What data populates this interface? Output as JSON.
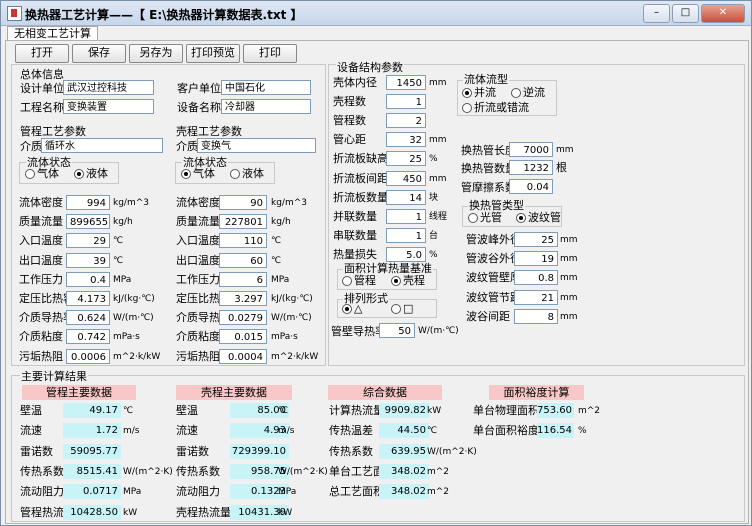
{
  "window": {
    "title": "换热器工艺计算——【 E:\\换热器计算数据表.txt 】",
    "btn_min": "–",
    "btn_max": "□",
    "btn_close": "✕"
  },
  "tab": "无相变工艺计算",
  "toolbar": {
    "open": "打开",
    "save": "保存",
    "saveas": "另存为",
    "preview": "打印预览",
    "print": "打印"
  },
  "general": {
    "title": "总体信息",
    "design_unit_label": "设计单位",
    "design_unit": "武汉过控科技",
    "customer_label": "客户单位",
    "customer": "中国石化",
    "project_label": "工程名称",
    "project": "变换装置",
    "equipment_label": "设备名称",
    "equipment": "冷却器"
  },
  "tube": {
    "title": "管程工艺参数",
    "medium_label": "介质",
    "medium": "循环水",
    "state_title": "流体状态",
    "gas": "气体",
    "liquid": "液体",
    "rows": [
      {
        "label": "流体密度",
        "value": "994",
        "unit": "kg/m^3"
      },
      {
        "label": "质量流量",
        "value": "899655",
        "unit": "kg/h"
      },
      {
        "label": "入口温度",
        "value": "29",
        "unit": "℃"
      },
      {
        "label": "出口温度",
        "value": "39",
        "unit": "℃"
      },
      {
        "label": "工作压力",
        "value": "0.4",
        "unit": "MPa"
      },
      {
        "label": "定压比热容",
        "value": "4.173",
        "unit": "kJ/(kg·℃)"
      },
      {
        "label": "介质导热率",
        "value": "0.624",
        "unit": "W/(m·℃)"
      },
      {
        "label": "介质粘度",
        "value": "0.742",
        "unit": "mPa·s"
      },
      {
        "label": "污垢热阻",
        "value": "0.0006",
        "unit": "m^2·k/kW"
      }
    ]
  },
  "shell": {
    "title": "壳程工艺参数",
    "medium_label": "介质",
    "medium": "变换气",
    "state_title": "流体状态",
    "gas": "气体",
    "liquid": "液体",
    "rows": [
      {
        "label": "流体密度",
        "value": "90",
        "unit": "kg/m^3"
      },
      {
        "label": "质量流量",
        "value": "227801",
        "unit": "kg/h"
      },
      {
        "label": "入口温度",
        "value": "110",
        "unit": "℃"
      },
      {
        "label": "出口温度",
        "value": "60",
        "unit": "℃"
      },
      {
        "label": "工作压力",
        "value": "6",
        "unit": "MPa"
      },
      {
        "label": "定压比热容",
        "value": "3.297",
        "unit": "kJ/(kg·℃)"
      },
      {
        "label": "介质导热率",
        "value": "0.0279",
        "unit": "W/(m·℃)"
      },
      {
        "label": "介质粘度",
        "value": "0.015",
        "unit": "mPa·s"
      },
      {
        "label": "污垢热阻",
        "value": "0.0004",
        "unit": "m^2·k/kW"
      }
    ]
  },
  "struct": {
    "title": "设备结构参数",
    "rows": [
      {
        "label": "壳体内径",
        "value": "1450",
        "unit": "mm"
      },
      {
        "label": "壳程数",
        "value": "1",
        "unit": ""
      },
      {
        "label": "管程数",
        "value": "2",
        "unit": ""
      },
      {
        "label": "管心距",
        "value": "32",
        "unit": "mm"
      },
      {
        "label": "折流板缺高",
        "value": "25",
        "unit": "%"
      },
      {
        "label": "折流板间距",
        "value": "450",
        "unit": "mm"
      },
      {
        "label": "折流板数量",
        "value": "14",
        "unit": "块"
      },
      {
        "label": "并联数量",
        "value": "1",
        "unit": "线程"
      },
      {
        "label": "串联数量",
        "value": "1",
        "unit": "台"
      },
      {
        "label": "热量损失",
        "value": "5.0",
        "unit": "%"
      }
    ],
    "flow_title": "流体流型",
    "cocurrent": "并流",
    "countercurrent": "逆流",
    "cross": "折流或错流",
    "tube_len_label": "换热管长度",
    "tube_len": "7000",
    "tube_len_unit": "mm",
    "tube_cnt_label": "换热管数量",
    "tube_cnt": "1232",
    "tube_cnt_unit": "根",
    "friction_label": "管摩擦系数",
    "friction": "0.04",
    "tubetype_title": "换热管类型",
    "smooth": "光管",
    "corrugated": "波纹管",
    "corr_rows": [
      {
        "label": "管波峰外径",
        "value": "25",
        "unit": "mm"
      },
      {
        "label": "管波谷外径",
        "value": "19",
        "unit": "mm"
      },
      {
        "label": "波纹管壁厚",
        "value": "0.8",
        "unit": "mm"
      },
      {
        "label": "波纹管节距",
        "value": "21",
        "unit": "mm"
      },
      {
        "label": "波谷间距",
        "value": "8",
        "unit": "mm"
      }
    ],
    "area_title": "面积计算热量基准",
    "area_tube": "管程",
    "area_shell": "壳程",
    "layout_title": "排列形式",
    "tri": "△",
    "sq": "□",
    "wall_k_label": "管壁导热率",
    "wall_k": "50",
    "wall_k_unit": "W/(m·℃)"
  },
  "results": {
    "title": "主要计算结果",
    "tube_hdr": "管程主要数据",
    "tube_rows": [
      {
        "label": "壁温",
        "value": "49.17",
        "unit": "℃"
      },
      {
        "label": "流速",
        "value": "1.72",
        "unit": "m/s"
      },
      {
        "label": "雷诺数",
        "value": "59095.77",
        "unit": ""
      },
      {
        "label": "传热系数",
        "value": "8515.41",
        "unit": "W/(m^2·K)"
      },
      {
        "label": "流动阻力",
        "value": "0.0717",
        "unit": "MPa"
      },
      {
        "label": "管程热流量",
        "value": "10428.50",
        "unit": "kW"
      }
    ],
    "shell_hdr": "壳程主要数据",
    "shell_rows": [
      {
        "label": "壁温",
        "value": "85.00",
        "unit": "℃"
      },
      {
        "label": "流速",
        "value": "4.93",
        "unit": "m/s"
      },
      {
        "label": "雷诺数",
        "value": "729399.10",
        "unit": ""
      },
      {
        "label": "传热系数",
        "value": "958.75",
        "unit": "W/(m^2·K)"
      },
      {
        "label": "流动阻力",
        "value": "0.1323",
        "unit": "MPa"
      },
      {
        "label": "壳程热流量",
        "value": "10431.39",
        "unit": "kW"
      }
    ],
    "comp_hdr": "综合数据",
    "comp_rows": [
      {
        "label": "计算热流量",
        "value": "9909.82",
        "unit": "kW"
      },
      {
        "label": "传热温差",
        "value": "44.50",
        "unit": "℃"
      },
      {
        "label": "传热系数",
        "value": "639.95",
        "unit": "W/(m^2·K)"
      },
      {
        "label": "单台工艺面积",
        "value": "348.02",
        "unit": "m^2"
      },
      {
        "label": "总工艺面积",
        "value": "348.02",
        "unit": "m^2"
      }
    ],
    "margin_hdr": "面积裕度计算",
    "margin_rows": [
      {
        "label": "单台物理面积",
        "value": "753.60",
        "unit": "m^2"
      },
      {
        "label": "单台面积裕度",
        "value": "116.54",
        "unit": "%"
      }
    ]
  }
}
